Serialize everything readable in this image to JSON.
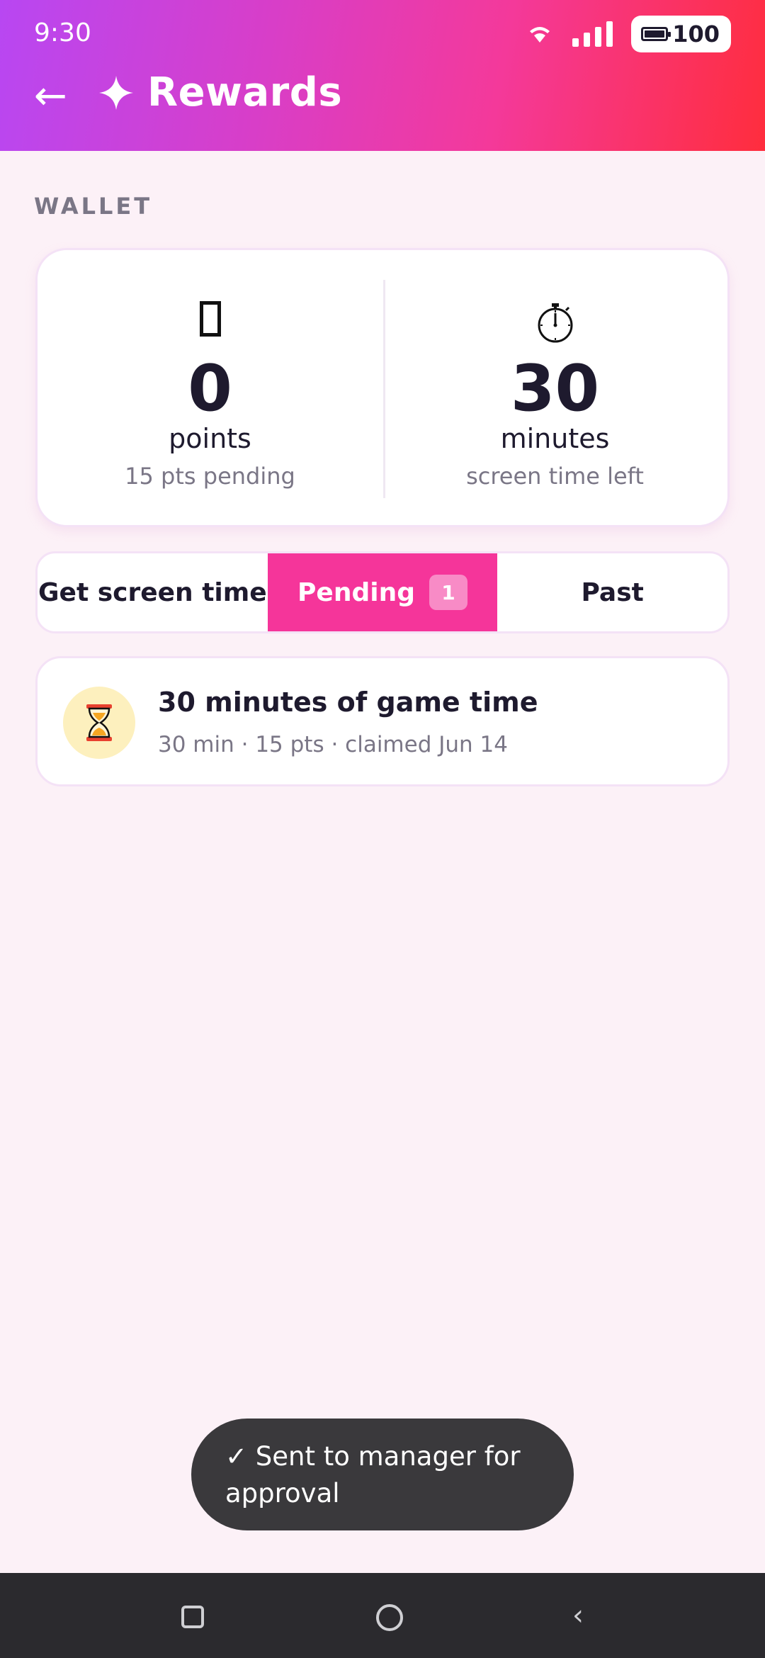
{
  "status_bar": {
    "time": "9:30",
    "battery": "100",
    "icons": [
      "wifi-icon",
      "signal-icon",
      "battery-icon"
    ]
  },
  "header": {
    "back_glyph": "←",
    "title": "Rewards",
    "title_icon": "sparkle-icon",
    "gradient": [
      "#b847f2",
      "#f4399a",
      "#ff2d3d"
    ]
  },
  "wallet": {
    "section_label": "WALLET",
    "points": {
      "icon": "coin-icon",
      "icon_glyph": "",
      "value": "0",
      "unit": "points",
      "sub": "15 pts pending"
    },
    "minutes": {
      "icon": "stopwatch-icon",
      "value": "30",
      "unit": "minutes",
      "sub": "screen time left"
    }
  },
  "tabs": [
    {
      "label": "Get screen time",
      "active": false
    },
    {
      "label": "Pending",
      "active": true,
      "badge": "1"
    },
    {
      "label": "Past",
      "active": false
    }
  ],
  "pending_items": [
    {
      "icon": "hourglass-icon",
      "title": "30 minutes of game time",
      "meta": "30 min · 15 pts · claimed Jun 14"
    }
  ],
  "toast": {
    "text": "✓ Sent to manager for approval"
  },
  "nav": {
    "back_glyph": "‹",
    "icons": [
      "recents-icon",
      "home-icon",
      "back-icon"
    ]
  },
  "colors": {
    "accent": "#f5359a",
    "background": "#fcf1f7",
    "text": "#1e1a2e",
    "muted": "#7a7686"
  }
}
